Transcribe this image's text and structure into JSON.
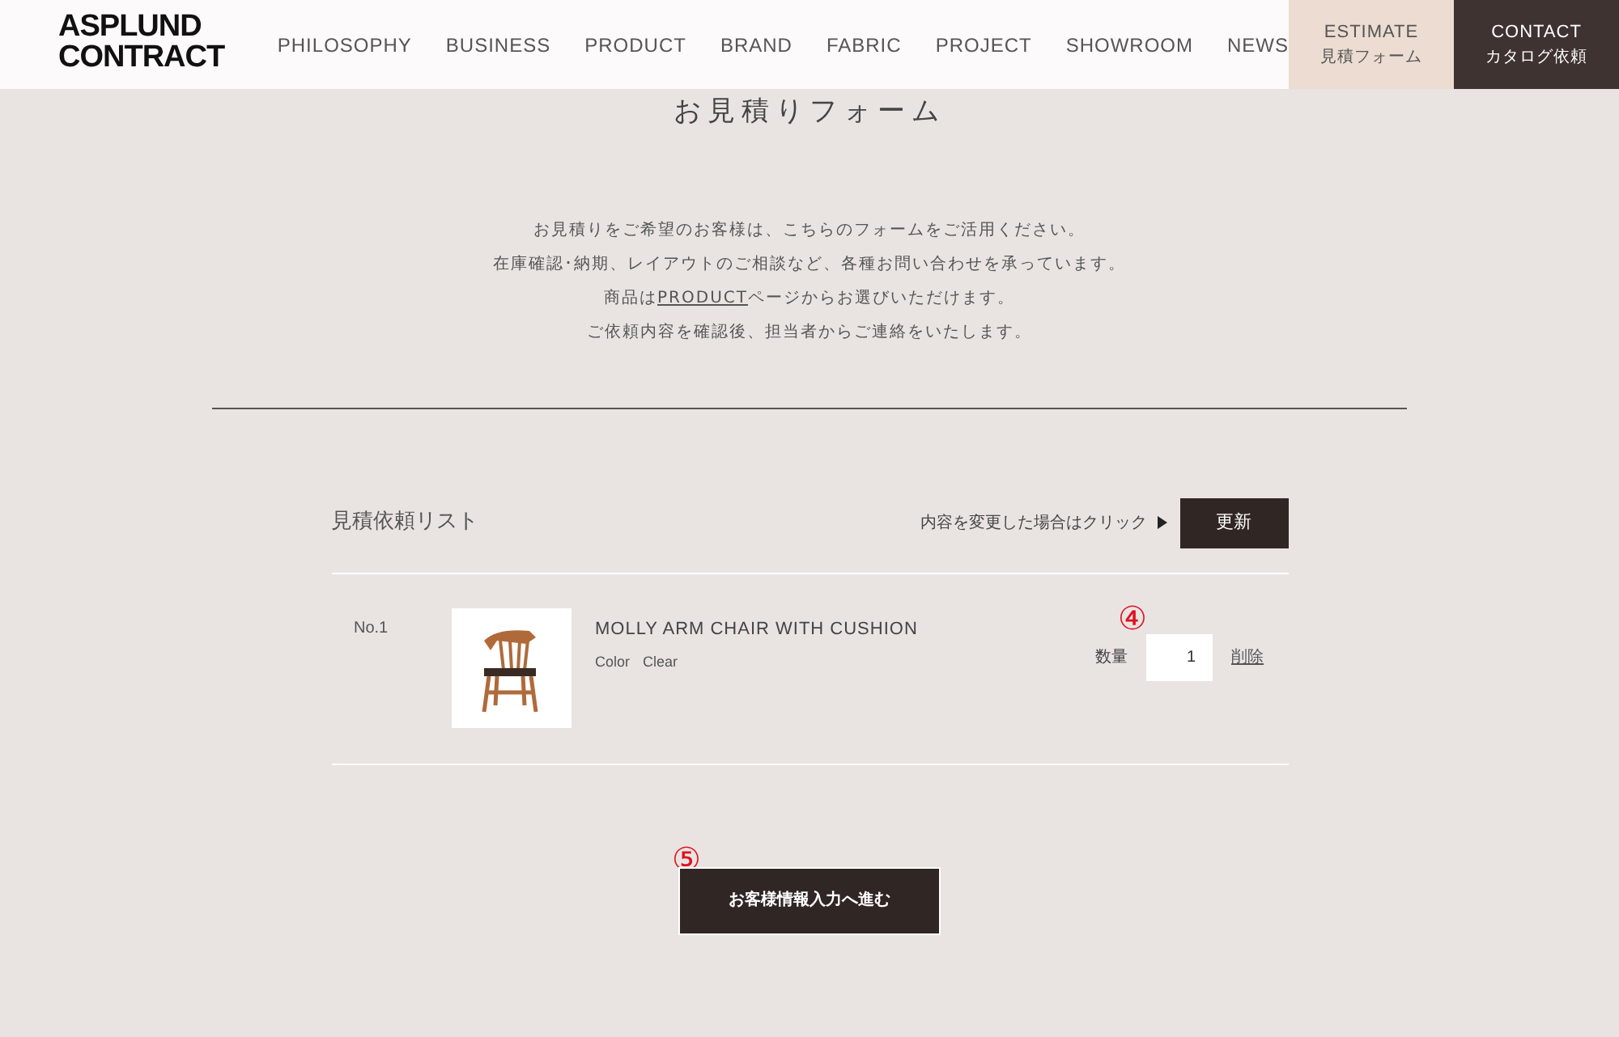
{
  "header": {
    "logo": [
      "ASPLUND",
      "CONTRACT"
    ],
    "nav": [
      "PHILOSOPHY",
      "BUSINESS",
      "PRODUCT",
      "BRAND",
      "FABRIC",
      "PROJECT",
      "SHOWROOM",
      "NEWS"
    ],
    "actions": [
      {
        "kind": "estimate",
        "label": "ESTIMATE",
        "sub": "見積フォーム"
      },
      {
        "kind": "contact",
        "label": "CONTACT",
        "sub": "カタログ依頼"
      }
    ]
  },
  "page_title": "お見積りフォーム",
  "intro": [
    {
      "text": "お見積りをご希望のお客様は、こちらのフォームをご活用ください。"
    },
    {
      "text": "在庫確認･納期、レイアウトのご相談など、各種お問い合わせを承っています。"
    },
    {
      "before": "商品は",
      "link": "PRODUCT",
      "after": "ページからお選びいただけます。"
    },
    {
      "text": "ご依頼内容を確認後、担当者からご連絡をいたします。"
    }
  ],
  "list": {
    "heading": "見積依頼リスト",
    "update_hint": "内容を変更した場合はクリック",
    "update_button": "更新",
    "items": [
      {
        "number": "No.1",
        "name": "MOLLY ARM CHAIR WITH CUSHION",
        "color_label": "Color",
        "color_value": "Clear",
        "quantity_label": "数量",
        "quantity": "1",
        "delete": "削除",
        "annotation": "④"
      }
    ]
  },
  "next": {
    "annotation": "⑤",
    "button": "お客様情報入力へ進む"
  }
}
